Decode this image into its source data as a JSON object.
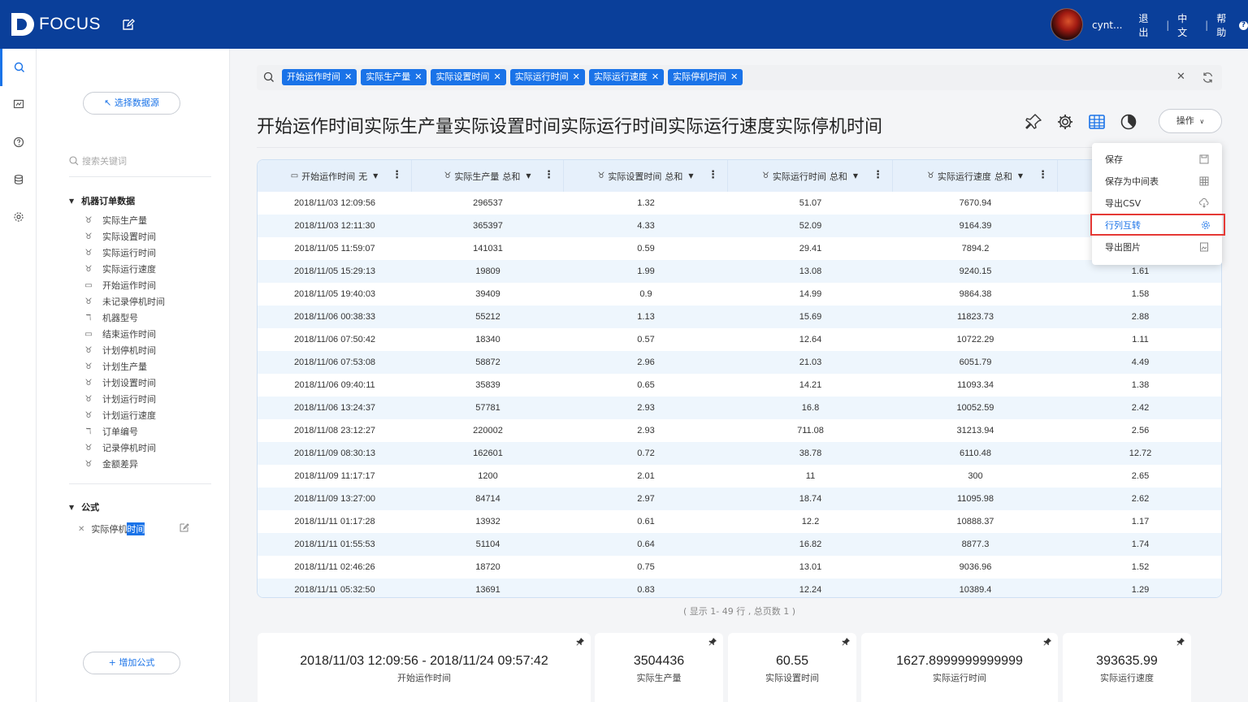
{
  "app": {
    "name": "FOCUS"
  },
  "header": {
    "user": "cynt...",
    "logout": "退出",
    "language": "中文",
    "help": "帮助"
  },
  "sidebar": {
    "select_data": "↖ 选择数据源",
    "search_placeholder": "搜索关键词",
    "group_title": "机器订单数据",
    "columns": [
      {
        "label": "实际生产量",
        "icon": "measure-icon"
      },
      {
        "label": "实际设置时间",
        "icon": "measure-icon"
      },
      {
        "label": "实际运行时间",
        "icon": "measure-icon"
      },
      {
        "label": "实际运行速度",
        "icon": "measure-icon"
      },
      {
        "label": "开始运作时间",
        "icon": "calendar-icon"
      },
      {
        "label": "未记录停机时间",
        "icon": "measure-icon"
      },
      {
        "label": "机器型号",
        "icon": "text-attr-icon"
      },
      {
        "label": "结束运作时间",
        "icon": "calendar-icon"
      },
      {
        "label": "计划停机时间",
        "icon": "measure-icon"
      },
      {
        "label": "计划生产量",
        "icon": "measure-icon"
      },
      {
        "label": "计划设置时间",
        "icon": "measure-icon"
      },
      {
        "label": "计划运行时间",
        "icon": "measure-icon"
      },
      {
        "label": "计划运行速度",
        "icon": "measure-icon"
      },
      {
        "label": "订单编号",
        "icon": "text-attr-icon"
      },
      {
        "label": "记录停机时间",
        "icon": "measure-icon"
      },
      {
        "label": "金额差异",
        "icon": "measure-icon"
      }
    ],
    "formula_title": "公式",
    "formula_item_prefix": "实际停机",
    "formula_item_selected": "时间",
    "add_formula": "+ 增加公式"
  },
  "search": {
    "chips": [
      "开始运作时间",
      "实际生产量",
      "实际设置时间",
      "实际运行时间",
      "实际运行速度",
      "实际停机时间"
    ]
  },
  "title": "开始运作时间实际生产量实际设置时间实际运行时间实际运行速度实际停机时间",
  "operate_button": "操作",
  "menu": {
    "items": [
      {
        "label": "保存",
        "icon": "save-icon"
      },
      {
        "label": "保存为中间表",
        "icon": "table-icon"
      },
      {
        "label": "导出CSV",
        "icon": "cloud-download-icon"
      },
      {
        "label": "行列互转",
        "icon": "gear-icon",
        "highlighted": true
      },
      {
        "label": "导出图片",
        "icon": "image-icon"
      }
    ]
  },
  "table": {
    "headers": [
      {
        "label": "开始运作时间",
        "agg": "无",
        "icon": "calendar-icon"
      },
      {
        "label": "实际生产量",
        "agg": "总和",
        "icon": "measure-icon"
      },
      {
        "label": "实际设置时间",
        "agg": "总和",
        "icon": "measure-icon"
      },
      {
        "label": "实际运行时间",
        "agg": "总和",
        "icon": "measure-icon"
      },
      {
        "label": "实际运行速度",
        "agg": "总和",
        "icon": "measure-icon"
      },
      {
        "label": "",
        "agg": "",
        "icon": "measure-icon"
      }
    ],
    "rows": [
      [
        "2018/11/03 12:09:56",
        "296537",
        "1.32",
        "51.07",
        "7670.94",
        ""
      ],
      [
        "2018/11/03 12:11:30",
        "365397",
        "4.33",
        "52.09",
        "9164.39",
        ""
      ],
      [
        "2018/11/05 11:59:07",
        "141031",
        "0.59",
        "29.41",
        "7894.2",
        ""
      ],
      [
        "2018/11/05 15:29:13",
        "19809",
        "1.99",
        "13.08",
        "9240.15",
        "1.61"
      ],
      [
        "2018/11/05 19:40:03",
        "39409",
        "0.9",
        "14.99",
        "9864.38",
        "1.58"
      ],
      [
        "2018/11/06 00:38:33",
        "55212",
        "1.13",
        "15.69",
        "11823.73",
        "2.88"
      ],
      [
        "2018/11/06 07:50:42",
        "18340",
        "0.57",
        "12.64",
        "10722.29",
        "1.11"
      ],
      [
        "2018/11/06 07:53:08",
        "58872",
        "2.96",
        "21.03",
        "6051.79",
        "4.49"
      ],
      [
        "2018/11/06 09:40:11",
        "35839",
        "0.65",
        "14.21",
        "11093.34",
        "1.38"
      ],
      [
        "2018/11/06 13:24:37",
        "57781",
        "2.93",
        "16.8",
        "10052.59",
        "2.42"
      ],
      [
        "2018/11/08 23:12:27",
        "220002",
        "2.93",
        "711.08",
        "31213.94",
        "2.56"
      ],
      [
        "2018/11/09 08:30:13",
        "162601",
        "0.72",
        "38.78",
        "6110.48",
        "12.72"
      ],
      [
        "2018/11/09 11:17:17",
        "1200",
        "2.01",
        "11",
        "300",
        "2.65"
      ],
      [
        "2018/11/09 13:27:00",
        "84714",
        "2.97",
        "18.74",
        "11095.98",
        "2.62"
      ],
      [
        "2018/11/11 01:17:28",
        "13932",
        "0.61",
        "12.2",
        "10888.37",
        "1.17"
      ],
      [
        "2018/11/11 01:55:53",
        "51104",
        "0.64",
        "16.82",
        "8877.3",
        "1.74"
      ],
      [
        "2018/11/11 02:46:26",
        "18720",
        "0.75",
        "13.01",
        "9036.96",
        "1.52"
      ],
      [
        "2018/11/11 05:32:50",
        "13691",
        "0.83",
        "12.24",
        "10389.4",
        "1.29"
      ]
    ],
    "footer": "( 显示 1- 49 行 , 总页数 1 )"
  },
  "cards": [
    {
      "value": "2018/11/03 12:09:56 - 2018/11/24 09:57:42",
      "label": "开始运作时间"
    },
    {
      "value": "3504436",
      "label": "实际生产量"
    },
    {
      "value": "60.55",
      "label": "实际设置时间"
    },
    {
      "value": "1627.8999999999999",
      "label": "实际运行时间"
    },
    {
      "value": "393635.99",
      "label": "实际运行速度"
    }
  ],
  "colors": {
    "brand": "#0a3f9a",
    "accent": "#1a73e8",
    "highlight_border": "#e53935"
  }
}
